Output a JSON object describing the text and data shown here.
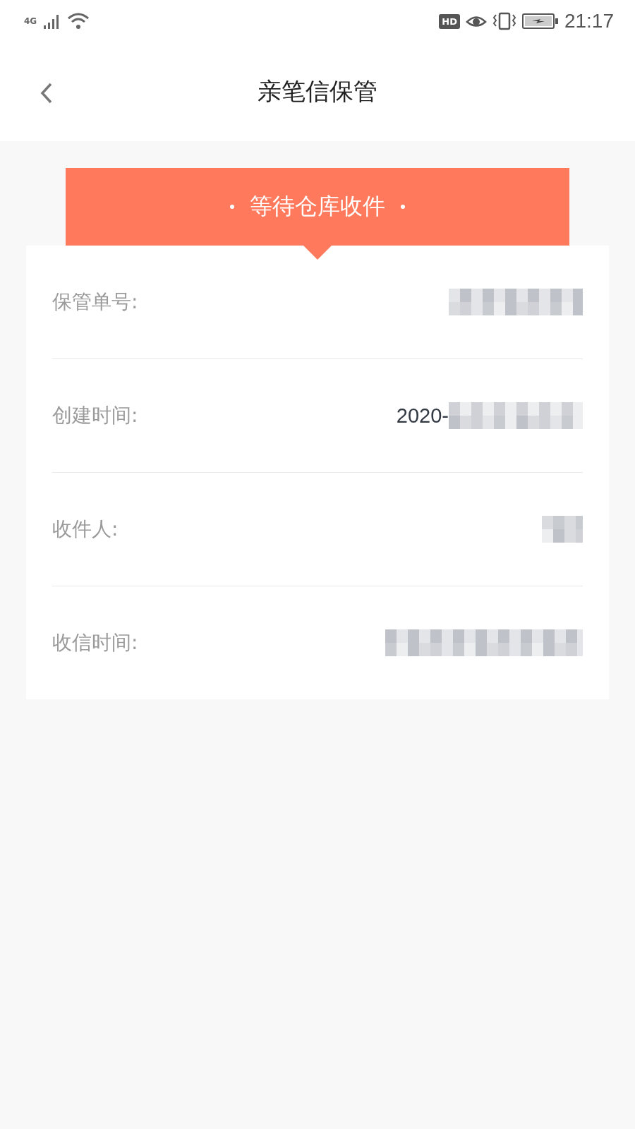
{
  "status_bar": {
    "network": "4G",
    "hd": "HD",
    "time": "21:17"
  },
  "header": {
    "title": "亲笔信保管"
  },
  "banner": {
    "text": "等待仓库收件"
  },
  "rows": [
    {
      "label": "保管单号:",
      "kind": "long"
    },
    {
      "label": "创建时间:",
      "prefix": "2020-",
      "kind": "long"
    },
    {
      "label": "收件人:",
      "kind": "short"
    },
    {
      "label": "收信时间:",
      "kind": "wide"
    }
  ]
}
